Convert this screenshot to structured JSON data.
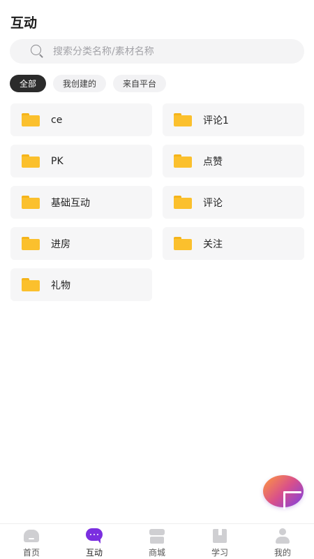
{
  "page": {
    "title": "互动"
  },
  "search": {
    "placeholder": "搜索分类名称/素材名称",
    "value": ""
  },
  "filters": [
    {
      "label": "全部",
      "active": true
    },
    {
      "label": "我创建的",
      "active": false
    },
    {
      "label": "来自平台",
      "active": false
    }
  ],
  "folders": [
    {
      "label": "ce"
    },
    {
      "label": "评论1"
    },
    {
      "label": "PK"
    },
    {
      "label": "点赞"
    },
    {
      "label": "基础互动"
    },
    {
      "label": "评论"
    },
    {
      "label": "进房"
    },
    {
      "label": "关注"
    },
    {
      "label": "礼物"
    }
  ],
  "fab": {
    "icon": "plus-icon"
  },
  "tabbar": [
    {
      "label": "首页",
      "icon": "home-icon",
      "active": false
    },
    {
      "label": "互动",
      "icon": "chat-icon",
      "active": true
    },
    {
      "label": "商城",
      "icon": "store-icon",
      "active": false
    },
    {
      "label": "学习",
      "icon": "book-icon",
      "active": false
    },
    {
      "label": "我的",
      "icon": "person-icon",
      "active": false
    }
  ],
  "colors": {
    "accent": "#7b2fe0",
    "folder": "#fbc02d",
    "chip_active_bg": "#2b2b2b",
    "fab_gradient": [
      "#ff9a3c",
      "#d9508a",
      "#7b3fe4"
    ]
  }
}
